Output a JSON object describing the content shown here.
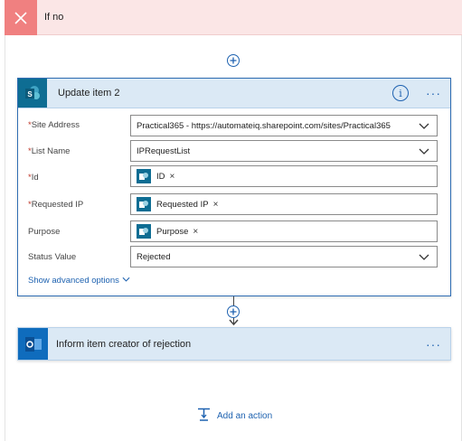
{
  "condition_branch": {
    "title": "If no"
  },
  "update_card": {
    "title": "Update item 2",
    "fields": [
      {
        "label": "Site Address",
        "required": true,
        "type": "dropdown",
        "value": "Practical365 - https://automateiq.sharepoint.com/sites/Practical365"
      },
      {
        "label": "List Name",
        "required": true,
        "type": "dropdown",
        "value": "IPRequestList"
      },
      {
        "label": "Id",
        "required": true,
        "type": "token",
        "value": "ID"
      },
      {
        "label": "Requested IP",
        "required": true,
        "type": "token",
        "value": "Requested IP"
      },
      {
        "label": "Purpose",
        "required": false,
        "type": "token",
        "value": "Purpose"
      },
      {
        "label": "Status Value",
        "required": false,
        "type": "dropdown",
        "value": "Rejected"
      }
    ],
    "show_advanced": "Show advanced options"
  },
  "outlook_card": {
    "title": "Inform item creator of rejection"
  },
  "add_action": {
    "label": "Add an action"
  },
  "colors": {
    "accent": "#1e62b0",
    "header_bg": "#dbe9f5",
    "sharepoint": "#0e6d93",
    "outlook": "#0f6cbd",
    "no_branch_bg": "#fbe6e6",
    "no_branch_icon": "#f08080"
  }
}
